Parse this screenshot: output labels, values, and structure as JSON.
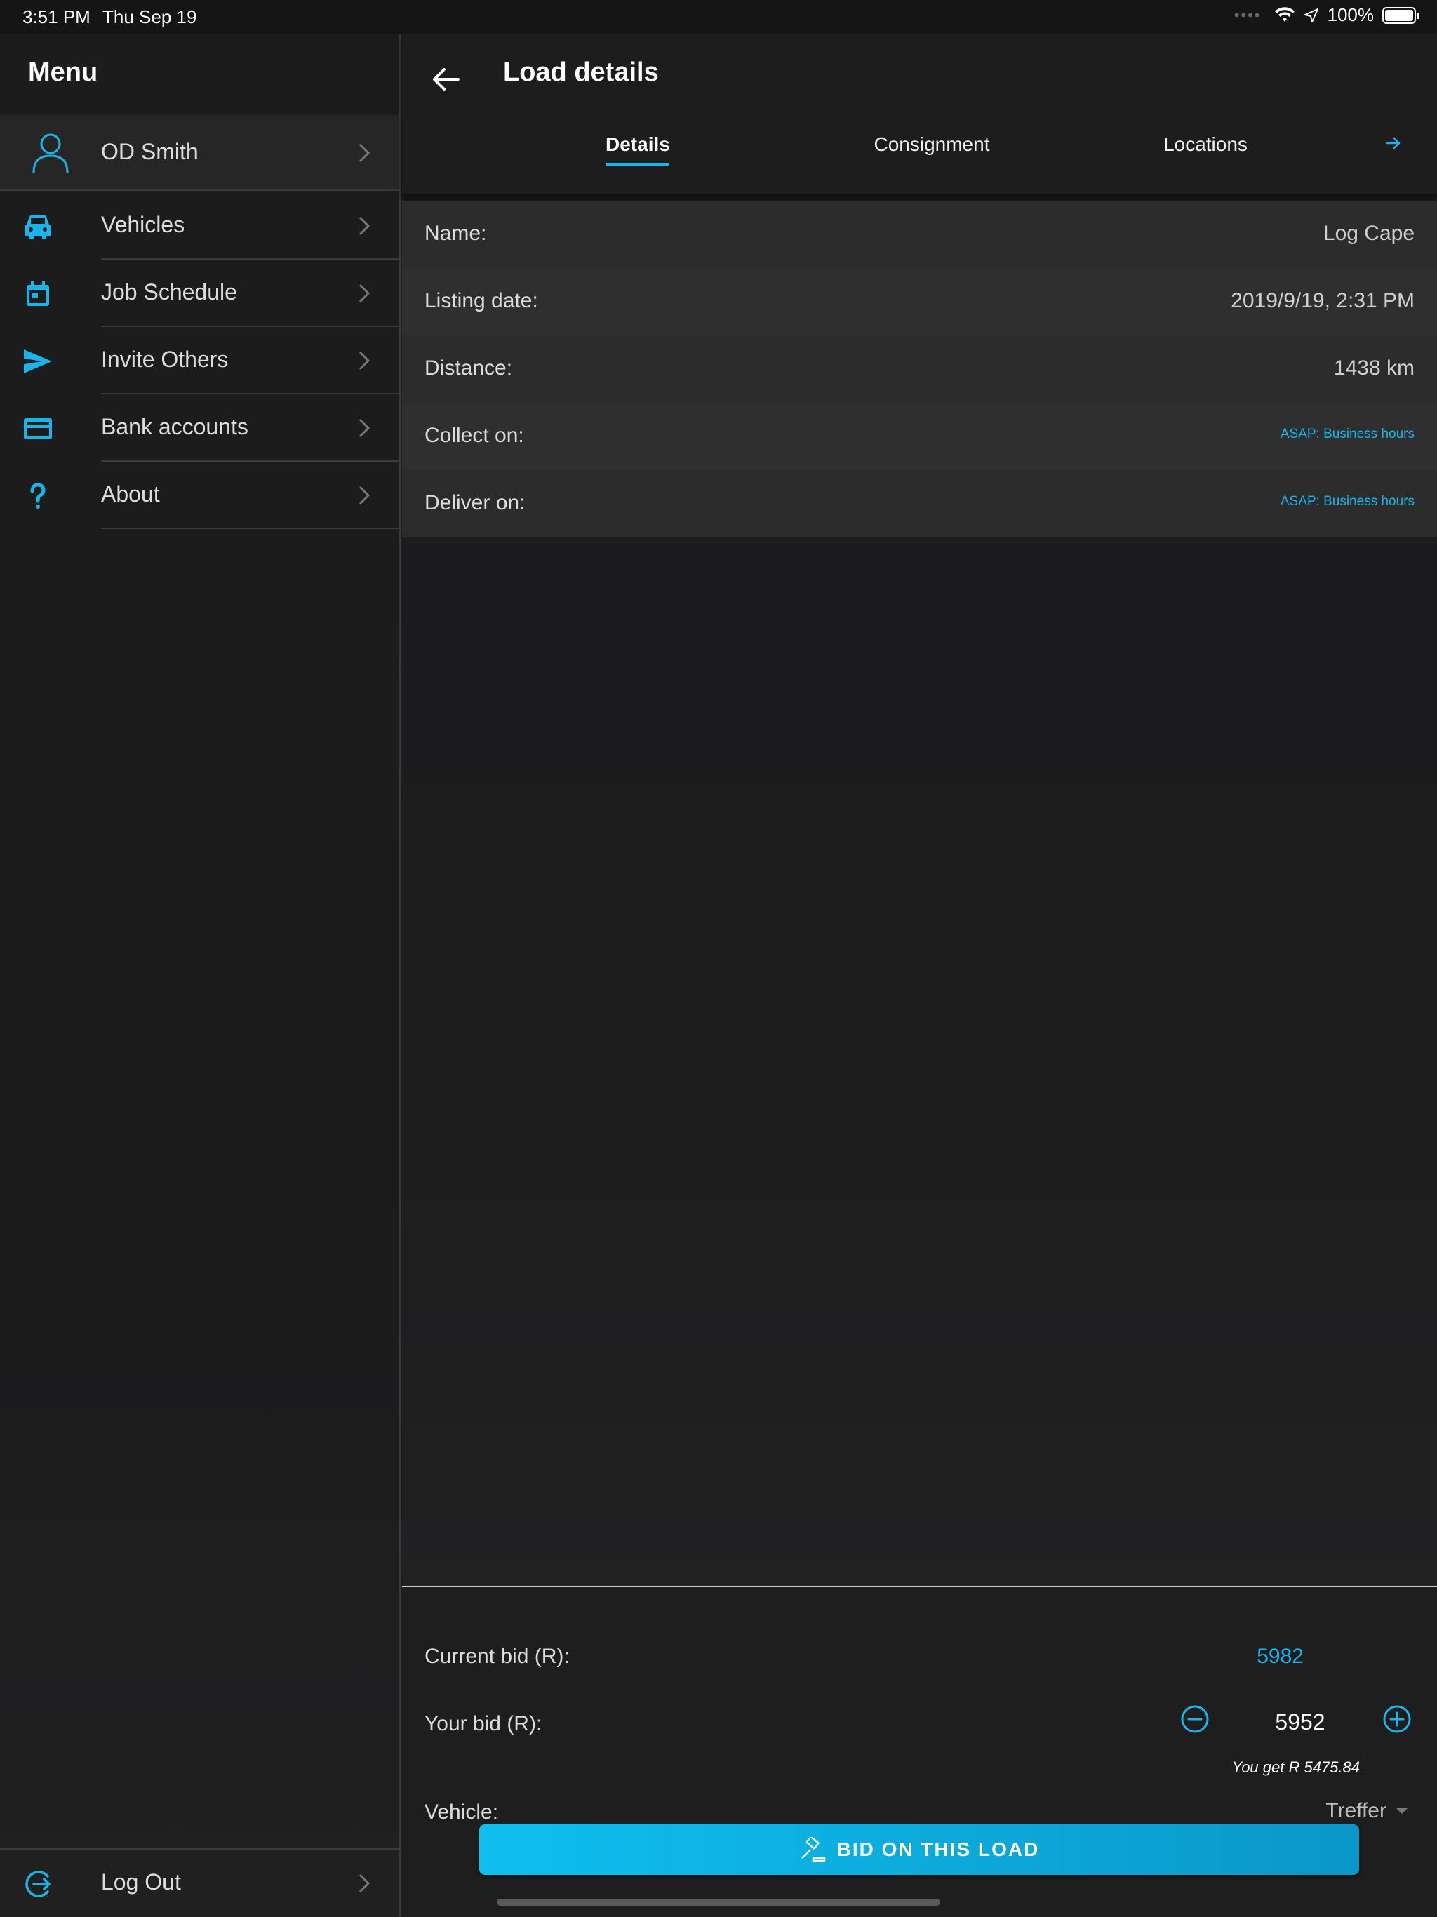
{
  "status_bar": {
    "time": "3:51 PM",
    "date": "Thu Sep 19",
    "battery": "100%"
  },
  "sidebar": {
    "title": "Menu",
    "profile": {
      "name": "OD Smith",
      "icon": "user-icon"
    },
    "items": [
      {
        "label": "Vehicles",
        "icon": "car-icon"
      },
      {
        "label": "Job Schedule",
        "icon": "calendar-icon"
      },
      {
        "label": "Invite Others",
        "icon": "send-icon"
      },
      {
        "label": "Bank accounts",
        "icon": "credit-card-icon"
      },
      {
        "label": "About",
        "icon": "question-icon"
      }
    ],
    "logout": {
      "label": "Log Out",
      "icon": "logout-icon"
    }
  },
  "header": {
    "title": "Load details",
    "tabs": [
      {
        "label": "Details",
        "active": true
      },
      {
        "label": "Consignment",
        "active": false
      },
      {
        "label": "Locations",
        "active": false
      }
    ]
  },
  "details": [
    {
      "key": "Name:",
      "value": "Log Cape"
    },
    {
      "key": "Listing date:",
      "value": "2019/9/19, 2:31 PM"
    },
    {
      "key": "Distance:",
      "value": "1438 km"
    },
    {
      "key": "Collect on:",
      "value": "ASAP: Business hours"
    },
    {
      "key": "Deliver on:",
      "value": "ASAP: Business hours"
    }
  ],
  "bid": {
    "current_label": "Current bid (R):",
    "current_value": "5982",
    "your_label": "Your bid (R):",
    "your_value": "5952",
    "you_get": "You get R 5475.84",
    "vehicle_label": "Vehicle:",
    "vehicle_value": "Treffer",
    "button_label": "BID ON THIS LOAD"
  },
  "colors": {
    "accent": "#18b4ea",
    "background": "#1e1e1f"
  }
}
